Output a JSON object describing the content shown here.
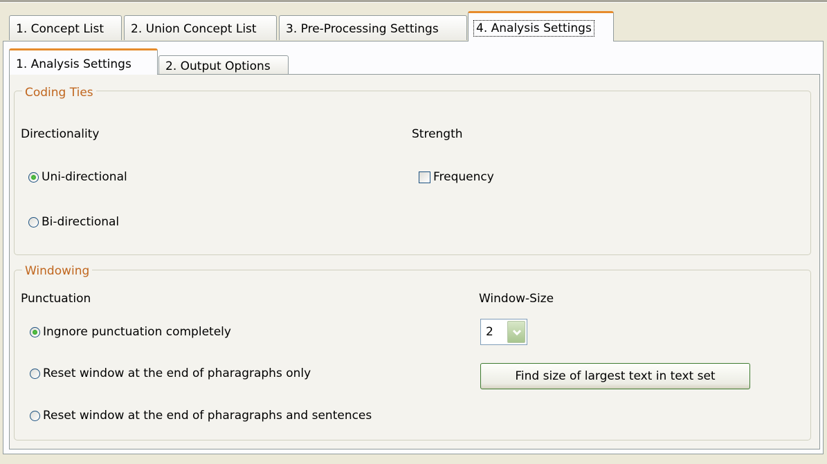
{
  "outer_tabs": [
    {
      "label": "1. Concept List"
    },
    {
      "label": "2. Union Concept List"
    },
    {
      "label": "3. Pre-Processing Settings"
    },
    {
      "label": "4. Analysis Settings"
    }
  ],
  "inner_tabs": [
    {
      "label": "1. Analysis Settings"
    },
    {
      "label": "2. Output Options"
    }
  ],
  "coding_ties": {
    "legend": "Coding Ties",
    "directionality": {
      "label": "Directionality",
      "options": [
        "Uni-directional",
        "Bi-directional"
      ],
      "selected": "Uni-directional"
    },
    "strength": {
      "label": "Strength",
      "frequency_label": "Frequency",
      "frequency_checked": false
    }
  },
  "windowing": {
    "legend": "Windowing",
    "punctuation": {
      "label": "Punctuation",
      "options": [
        "Ingnore punctuation completely",
        "Reset window at the end of pharagraphs only",
        "Reset window at the end of pharagraphs and sentences"
      ],
      "selected": "Ingnore punctuation completely"
    },
    "window_size": {
      "label": "Window-Size",
      "value": "2"
    },
    "find_button_label": "Find size of largest text in text set"
  },
  "colors": {
    "accent_tab": "#e68b2c",
    "legend_text": "#c0661e",
    "radio_dot": "#21a121",
    "combo_arrow": "#a8c58f"
  }
}
